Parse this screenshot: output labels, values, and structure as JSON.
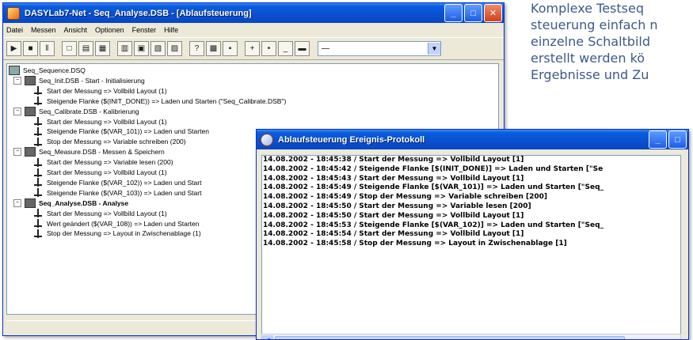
{
  "article": {
    "lines": [
      "Komplexe Testseq",
      "steuerung einfach n",
      "einzelne Schaltbild",
      "erstellt werden kö",
      "Ergebnisse und Zu"
    ]
  },
  "main_window": {
    "title": "DASYLab7-Net - Seq_Analyse.DSB - [Ablaufsteuerung]",
    "menu": [
      "Datei",
      "Messen",
      "Ansicht",
      "Optionen",
      "Fenster",
      "Hilfe"
    ],
    "toolbar": {
      "buttons": [
        "▶",
        "■",
        "‖",
        "□",
        "▤",
        "▦",
        "▥",
        "▣",
        "▧",
        "▨",
        "?",
        "▩",
        "▪",
        "+",
        "•",
        "_",
        "▬"
      ],
      "combo_value": "—"
    },
    "tree": {
      "root": "Seq_Sequence.DSQ",
      "groups": [
        {
          "name": "Seq_Init.DSB - Start - Initialisierung",
          "bold": false,
          "items": [
            "Start der Messung  =>  Vollbild Layout (1)",
            "Steigende Flanke ($(INIT_DONE))  =>  Laden und Starten (\"Seq_Calibrate.DSB\")"
          ]
        },
        {
          "name": "Seq_Calibrate.DSB - Kalibrierung",
          "bold": false,
          "items": [
            "Start der Messung  =>  Vollbild Layout (1)",
            "Steigende Flanke ($(VAR_101))  =>  Laden und Starten",
            "Stop der Messung  =>  Variable schreiben (200)"
          ]
        },
        {
          "name": "Seq_Measure.DSB - Messen & Speichern",
          "bold": false,
          "items": [
            "Start der Messung  =>  Variable lesen (200)",
            "Start der Messung  =>  Vollbild Layout (1)",
            "Steigende Flanke ($(VAR_102))  =>  Laden und Start",
            "Steigende Flanke ($(VAR_103))  =>  Laden und Start"
          ]
        },
        {
          "name": "Seq_Analyse.DSB - Analyse",
          "bold": true,
          "items": [
            "Start der Messung  =>  Vollbild Layout (1)",
            "Wert geändert ($(VAR_108))  =>  Laden und Starten",
            "Stop der Messung  =>  Layout in Zwischenablage (1)"
          ]
        }
      ]
    }
  },
  "protocol_window": {
    "title": "Ablaufsteuerung Ereignis-Protokoll",
    "lines": [
      "14.08.2002 - 18:45:38 / Start der Messung   =>   Vollbild Layout [1]",
      "14.08.2002 - 18:45:42 / Steigende Flanke [$(INIT_DONE)]   =>   Laden und Starten [\"Se",
      "14.08.2002 - 18:45:43 / Start der Messung   =>   Vollbild Layout [1]",
      "14.08.2002 - 18:45:49 / Steigende Flanke [$(VAR_101)]   =>   Laden und Starten [\"Seq_",
      "14.08.2002 - 18:45:49 / Stop der Messung   =>   Variable schreiben [200]",
      "14.08.2002 - 18:45:50 / Start der Messung   =>   Variable lesen [200]",
      "14.08.2002 - 18:45:50 / Start der Messung   =>   Vollbild Layout [1]",
      "14.08.2002 - 18:45:53 / Steigende Flanke [$(VAR_102)]   =>   Laden und Starten [\"Seq_",
      "14.08.2002 - 18:45:54 / Start der Messung   =>   Vollbild Layout [1]",
      "14.08.2002 - 18:45:58 / Stop der Messung   =>   Layout in Zwischenablage [1]"
    ]
  }
}
